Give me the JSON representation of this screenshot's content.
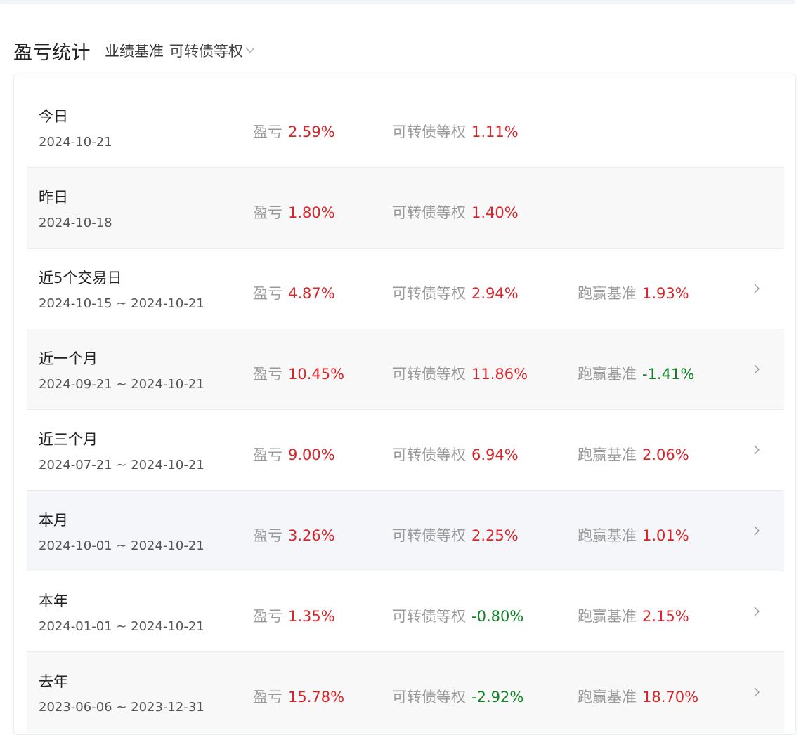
{
  "header": {
    "title": "盈亏统计",
    "benchmark_label": "业绩基准",
    "benchmark_value": "可转债等权"
  },
  "colors": {
    "positive": "#d9252a",
    "negative": "#128226",
    "label": "#9a9a9a"
  },
  "rows": [
    {
      "period": "今日",
      "date": "2024-10-21",
      "pl_label": "盈亏",
      "pl": "2.59%",
      "bench_label": "可转债等权",
      "bench": "1.11%",
      "excess_label": "",
      "excess": ""
    },
    {
      "period": "昨日",
      "date": "2024-10-18",
      "pl_label": "盈亏",
      "pl": "1.80%",
      "bench_label": "可转债等权",
      "bench": "1.40%",
      "excess_label": "",
      "excess": ""
    },
    {
      "period": "近5个交易日",
      "date": "2024-10-15 ~ 2024-10-21",
      "pl_label": "盈亏",
      "pl": "4.87%",
      "bench_label": "可转债等权",
      "bench": "2.94%",
      "excess_label": "跑赢基准",
      "excess": "1.93%"
    },
    {
      "period": "近一个月",
      "date": "2024-09-21 ~ 2024-10-21",
      "pl_label": "盈亏",
      "pl": "10.45%",
      "bench_label": "可转债等权",
      "bench": "11.86%",
      "excess_label": "跑赢基准",
      "excess": "-1.41%"
    },
    {
      "period": "近三个月",
      "date": "2024-07-21 ~ 2024-10-21",
      "pl_label": "盈亏",
      "pl": "9.00%",
      "bench_label": "可转债等权",
      "bench": "6.94%",
      "excess_label": "跑赢基准",
      "excess": "2.06%"
    },
    {
      "period": "本月",
      "date": "2024-10-01 ~ 2024-10-21",
      "pl_label": "盈亏",
      "pl": "3.26%",
      "bench_label": "可转债等权",
      "bench": "2.25%",
      "excess_label": "跑赢基准",
      "excess": "1.01%"
    },
    {
      "period": "本年",
      "date": "2024-01-01 ~ 2024-10-21",
      "pl_label": "盈亏",
      "pl": "1.35%",
      "bench_label": "可转债等权",
      "bench": "-0.80%",
      "excess_label": "跑赢基准",
      "excess": "2.15%"
    },
    {
      "period": "去年",
      "date": "2023-06-06 ~ 2023-12-31",
      "pl_label": "盈亏",
      "pl": "15.78%",
      "bench_label": "可转债等权",
      "bench": "-2.92%",
      "excess_label": "跑赢基准",
      "excess": "18.70%"
    }
  ]
}
